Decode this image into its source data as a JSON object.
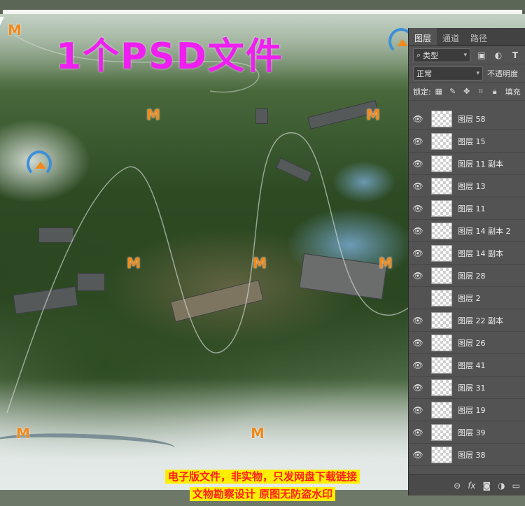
{
  "headline": "1个PSD文件",
  "captions": {
    "line1": "电子版文件，非实物，只发网盘下载链接",
    "line2": "文物勘察设计  原图无防盗水印"
  },
  "watermark": {
    "letter": "M"
  },
  "colors": {
    "headline": "#ee1ff0",
    "caption_text": "#ff1f1f",
    "caption_bg": "#ffee00",
    "watermark_orange": "#f08a1e",
    "watermark_blue": "#3d8fd8",
    "panel_bg": "#535353"
  },
  "panel": {
    "tabs": [
      "图层",
      "通道",
      "路径"
    ],
    "active_tab": "图层",
    "filter": {
      "value": "类型",
      "icons": [
        "image-filter-icon",
        "adjustment-filter-icon",
        "move-filter-icon",
        "type-filter-icon"
      ]
    },
    "blend_mode": "正常",
    "opacity_label": "不透明度",
    "lock_label": "锁定:",
    "fill_label": "填充",
    "layers": [
      {
        "name": "图层 58",
        "visible": true
      },
      {
        "name": "图层 15",
        "visible": true
      },
      {
        "name": "图层 11 副本",
        "visible": true
      },
      {
        "name": "图层 13",
        "visible": true
      },
      {
        "name": "图层 11",
        "visible": true
      },
      {
        "name": "图层 14 副本 2",
        "visible": true
      },
      {
        "name": "图层 14 副本",
        "visible": true
      },
      {
        "name": "图层 28",
        "visible": true
      },
      {
        "name": "图层 2",
        "visible": false
      },
      {
        "name": "图层 22 副本",
        "visible": true
      },
      {
        "name": "图层 26",
        "visible": true
      },
      {
        "name": "图层 41",
        "visible": true
      },
      {
        "name": "图层 31",
        "visible": true
      },
      {
        "name": "图层 19",
        "visible": true
      },
      {
        "name": "图层 39",
        "visible": true
      },
      {
        "name": "图层 38",
        "visible": true
      }
    ],
    "bottom_icons": [
      "link-icon",
      "fx-icon",
      "mask-icon",
      "adjustment-icon",
      "folder-icon"
    ]
  }
}
